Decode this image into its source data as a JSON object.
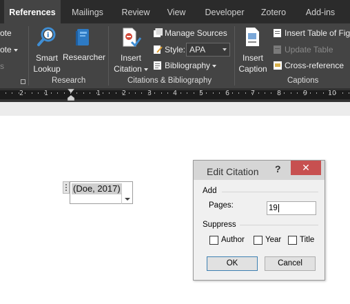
{
  "tabs": [
    {
      "label": "References",
      "active": true
    },
    {
      "label": "Mailings"
    },
    {
      "label": "Review"
    },
    {
      "label": "View"
    },
    {
      "label": "Developer"
    },
    {
      "label": "Zotero"
    },
    {
      "label": "Add-ins"
    }
  ],
  "ribbon": {
    "partial_left": [
      "ote",
      "ote",
      "s"
    ],
    "research": {
      "smart_lookup": [
        "Smart",
        "Lookup"
      ],
      "researcher": "Researcher",
      "group_label": "Research"
    },
    "citations": {
      "insert_citation": [
        "Insert",
        "Citation"
      ],
      "manage_sources": "Manage Sources",
      "style_label": "Style:",
      "style_value": "APA",
      "bibliography": "Bibliography",
      "group_label": "Citations & Bibliography"
    },
    "captions": {
      "insert_caption": [
        "Insert",
        "Caption"
      ],
      "insert_table_of_figures": "Insert Table of Fig",
      "update_table": "Update Table",
      "cross_reference": "Cross-reference",
      "group_label": "Captions"
    }
  },
  "ruler": {
    "labels": [
      "2",
      "1",
      "1",
      "2",
      "3",
      "4",
      "5",
      "6",
      "7",
      "8",
      "9",
      "10"
    ]
  },
  "citation_control": {
    "text": "(Doe, 2017)"
  },
  "dialog": {
    "title": "Edit Citation",
    "help": "?",
    "close": "✕",
    "add_label": "Add",
    "pages_label": "Pages:",
    "pages_value": "19",
    "suppress_label": "Suppress",
    "checkboxes": [
      {
        "label": "Author",
        "checked": false
      },
      {
        "label": "Year",
        "checked": false
      },
      {
        "label": "Title",
        "checked": false
      }
    ],
    "ok": "OK",
    "cancel": "Cancel"
  },
  "colors": {
    "tabbar_bg": "#2b2b2b",
    "ribbon_bg": "#444444",
    "close_button": "#c75050",
    "ok_border": "#3c7fb1"
  }
}
